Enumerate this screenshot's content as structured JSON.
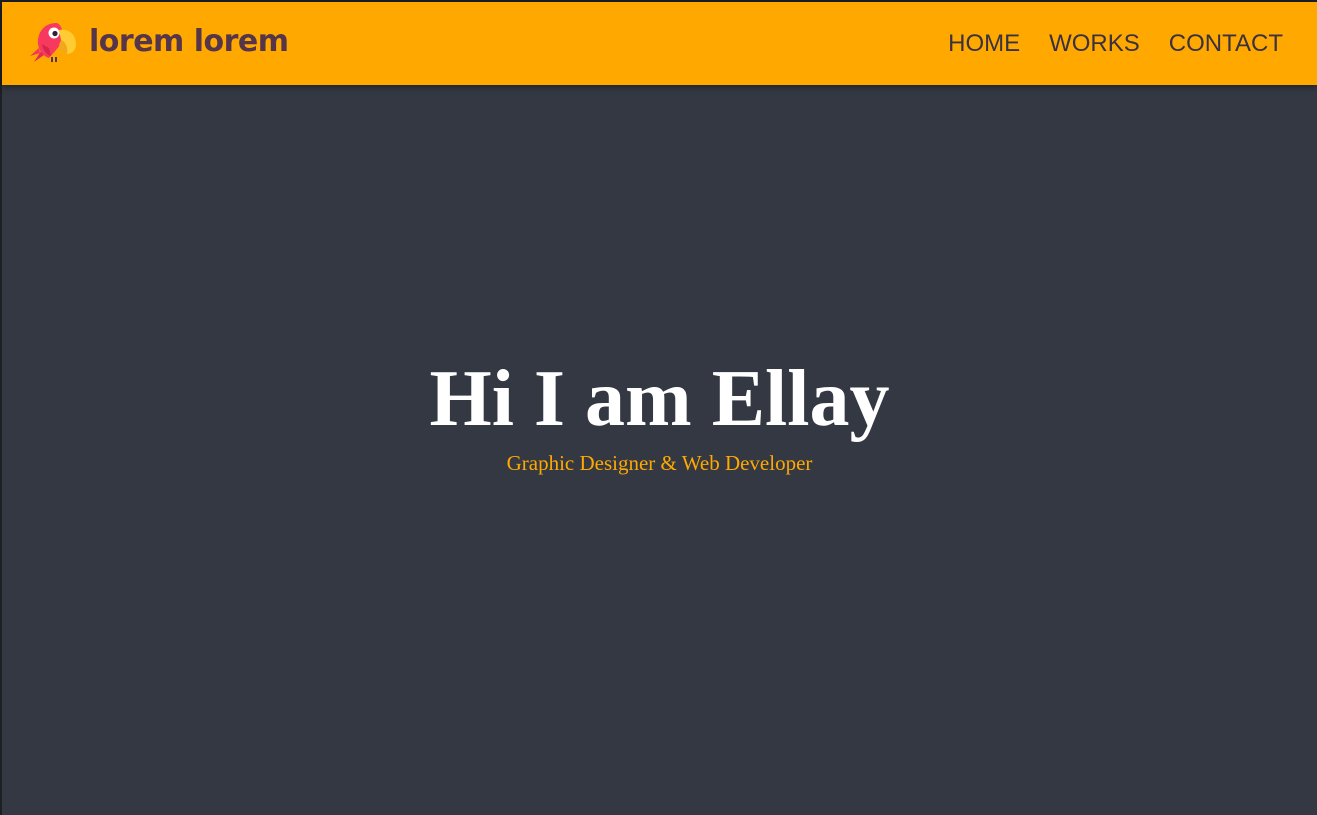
{
  "navbar": {
    "brand": {
      "logo_icon": "parrot-logo-icon",
      "name": "lorem lorem"
    },
    "links": [
      {
        "label": "HOME"
      },
      {
        "label": "WORKS"
      },
      {
        "label": "CONTACT"
      }
    ],
    "background_color": "#ffa800"
  },
  "hero": {
    "title": "Hi I am Ellay",
    "subtitle": "Graphic Designer & Web Developer",
    "background_color": "#333842",
    "accent_color": "#ffa800"
  }
}
